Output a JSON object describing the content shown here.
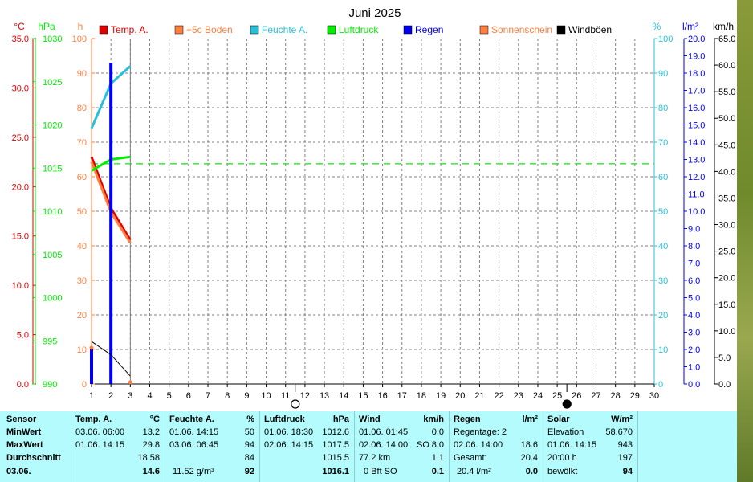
{
  "title": "Juni 2025",
  "colors": {
    "temp": "#e00000",
    "boden": "#ff7f3f",
    "feuchte": "#27c0d8",
    "luftdruck": "#00ee00",
    "regen": "#0000ee",
    "sonne": "#ff7f3f",
    "wind": "#000000",
    "panel": "#b3fbfd"
  },
  "axes": {
    "temp_unit": "°C",
    "temp_ticks": [
      "35.0",
      "30.0",
      "25.0",
      "20.0",
      "15.0",
      "10.0",
      "5.0",
      "0.0"
    ],
    "hpa_unit": "hPa",
    "hpa_ticks": [
      "1030",
      "1025",
      "1020",
      "1015",
      "1010",
      "1005",
      "1000",
      "995",
      "990"
    ],
    "h_unit": "h",
    "h_ticks": [
      "100",
      "90",
      "80",
      "70",
      "60",
      "50",
      "40",
      "30",
      "20",
      "10",
      "0"
    ],
    "pct_unit": "%",
    "pct_ticks": [
      "100",
      "90",
      "80",
      "70",
      "60",
      "50",
      "40",
      "30",
      "20",
      "10",
      "0"
    ],
    "rain_unit": "l/m²",
    "rain_ticks": [
      "20.0",
      "19.0",
      "18.0",
      "17.0",
      "16.0",
      "15.0",
      "14.0",
      "13.0",
      "12.0",
      "11.0",
      "10.0",
      "9.0",
      "8.0",
      "7.0",
      "6.0",
      "5.0",
      "4.0",
      "3.0",
      "2.0",
      "1.0",
      "0.0"
    ],
    "wind_unit": "km/h",
    "wind_ticks": [
      "65.0",
      "60.0",
      "55.0",
      "50.0",
      "45.0",
      "40.0",
      "35.0",
      "30.0",
      "25.0",
      "20.0",
      "15.0",
      "10.0",
      "5.0",
      "0.0"
    ],
    "x_ticks": [
      "1",
      "2",
      "3",
      "4",
      "5",
      "6",
      "7",
      "8",
      "9",
      "10",
      "11",
      "12",
      "13",
      "14",
      "15",
      "16",
      "17",
      "18",
      "19",
      "20",
      "21",
      "22",
      "23",
      "24",
      "25",
      "26",
      "27",
      "28",
      "29",
      "30"
    ]
  },
  "legend": [
    {
      "label": "Temp. A.",
      "color": "#e00000"
    },
    {
      "label": "+5c Boden",
      "color": "#ff7f3f"
    },
    {
      "label": "Feuchte A.",
      "color": "#27c0d8"
    },
    {
      "label": "Luftdruck",
      "color": "#00ee00"
    },
    {
      "label": "Regen",
      "color": "#0000ee"
    },
    {
      "label": "Sonnenschein",
      "color": "#ff7f3f"
    },
    {
      "label": "Windböen",
      "color": "#000000"
    }
  ],
  "chart_data": {
    "type": "line",
    "title": "Juni 2025",
    "x": [
      1,
      2,
      3
    ],
    "xlim": [
      1,
      30
    ],
    "series": [
      {
        "name": "Temp. A.",
        "axis": "°C",
        "values": [
          23.0,
          17.8,
          14.6
        ]
      },
      {
        "name": "+5c Boden",
        "axis": "°C",
        "values": [
          22.5,
          17.4,
          14.3
        ]
      },
      {
        "name": "Feuchte A.",
        "axis": "%",
        "values": [
          74,
          87,
          92
        ]
      },
      {
        "name": "Luftdruck",
        "axis": "hPa",
        "values": [
          1014.7,
          1016.0,
          1016.3
        ]
      },
      {
        "name": "Regen",
        "axis": "l/m²",
        "type": "bar",
        "values": [
          2.0,
          18.6,
          0.0
        ]
      },
      {
        "name": "Sonnenschein",
        "axis": "h",
        "values": [
          10.5,
          null,
          0.5
        ]
      },
      {
        "name": "Windböen",
        "axis": "km/h",
        "values": [
          8.0,
          5.5,
          1.5
        ]
      }
    ],
    "reference_line": {
      "axis": "hPa",
      "value": 1015.5,
      "style": "dashed"
    },
    "moon_phases": [
      {
        "day": 11,
        "phase": "full"
      },
      {
        "day": 25,
        "phase": "new"
      }
    ],
    "ylim_temp": [
      0,
      35
    ],
    "ylim_hpa": [
      990,
      1030
    ],
    "ylim_pct": [
      0,
      100
    ],
    "ylim_rain": [
      0,
      20
    ],
    "ylim_wind": [
      0,
      65
    ],
    "grid": true
  },
  "panel": {
    "sensor": {
      "head": "Sensor",
      "min": "MinWert",
      "max": "MaxWert",
      "avg": "Durchschnitt",
      "date": "03.06."
    },
    "temp": {
      "head": "Temp. A.",
      "unit": "°C",
      "min_time": "03.06.  06:00",
      "min_val": "13.2",
      "max_time": "01.06.  14:15",
      "max_val": "29.8",
      "avg": "18.58",
      "cur": "14.6"
    },
    "feuchte": {
      "head": "Feuchte A.",
      "unit": "%",
      "min_time": "01.06.  14:15",
      "min_val": "50",
      "max_time": "03.06.  06:45",
      "max_val": "94",
      "avg": "84",
      "abs": "11.52 g/m³",
      "cur": "92"
    },
    "luftdruck": {
      "head": "Luftdruck",
      "unit": "hPa",
      "min_time": "01.06.  18:30",
      "min_val": "1012.6",
      "max_time": "02.06.  14:15",
      "max_val": "1017.5",
      "avg": "1015.5",
      "cur": "1016.1"
    },
    "wind": {
      "head": "Wind",
      "unit": "km/h",
      "min_time": "01.06.  01:45",
      "min_val": "0.0",
      "max_time": "02.06.  14:00",
      "max_dir": "SO",
      "max_val": "8.0",
      "dist": "77.2 km",
      "avg": "1.1",
      "bft": "0 Bft SO",
      "cur": "0.1"
    },
    "regen": {
      "head": "Regen",
      "unit": "l/m²",
      "tage": "Regentage: 2",
      "max_time": "02.06.  14:00",
      "max_val": "18.6",
      "gesamt": "Gesamt:",
      "gesamt_val": "20.4",
      "cur_l": "20.4 l/m²",
      "cur": "0.0"
    },
    "solar": {
      "head": "Solar",
      "unit": "W/m²",
      "elev": "Elevation",
      "elev_val": "58.670",
      "max_time": "01.06.  14:15",
      "max_val": "943",
      "sun_h": "20:00 h",
      "sun_val": "197",
      "sky": "bewölkt",
      "cur": "94"
    }
  }
}
